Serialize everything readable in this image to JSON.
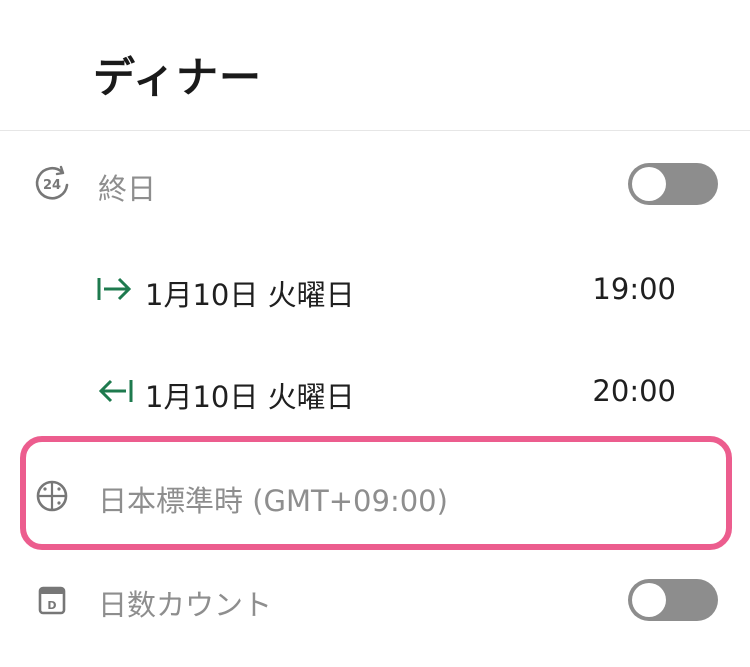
{
  "header": {
    "title": "ディナー"
  },
  "all_day": {
    "label": "終日",
    "enabled": false
  },
  "start": {
    "date": "1月10日 火曜日",
    "time": "19:00"
  },
  "end": {
    "date": "1月10日 火曜日",
    "time": "20:00"
  },
  "timezone": {
    "label": "日本標準時 (GMT+09:00)"
  },
  "day_count": {
    "label": "日数カウント",
    "enabled": false
  },
  "colors": {
    "arrow_green": "#1e7a4e",
    "highlight_pink": "#ec5d8e",
    "toggle_off": "#8d8d8d"
  }
}
